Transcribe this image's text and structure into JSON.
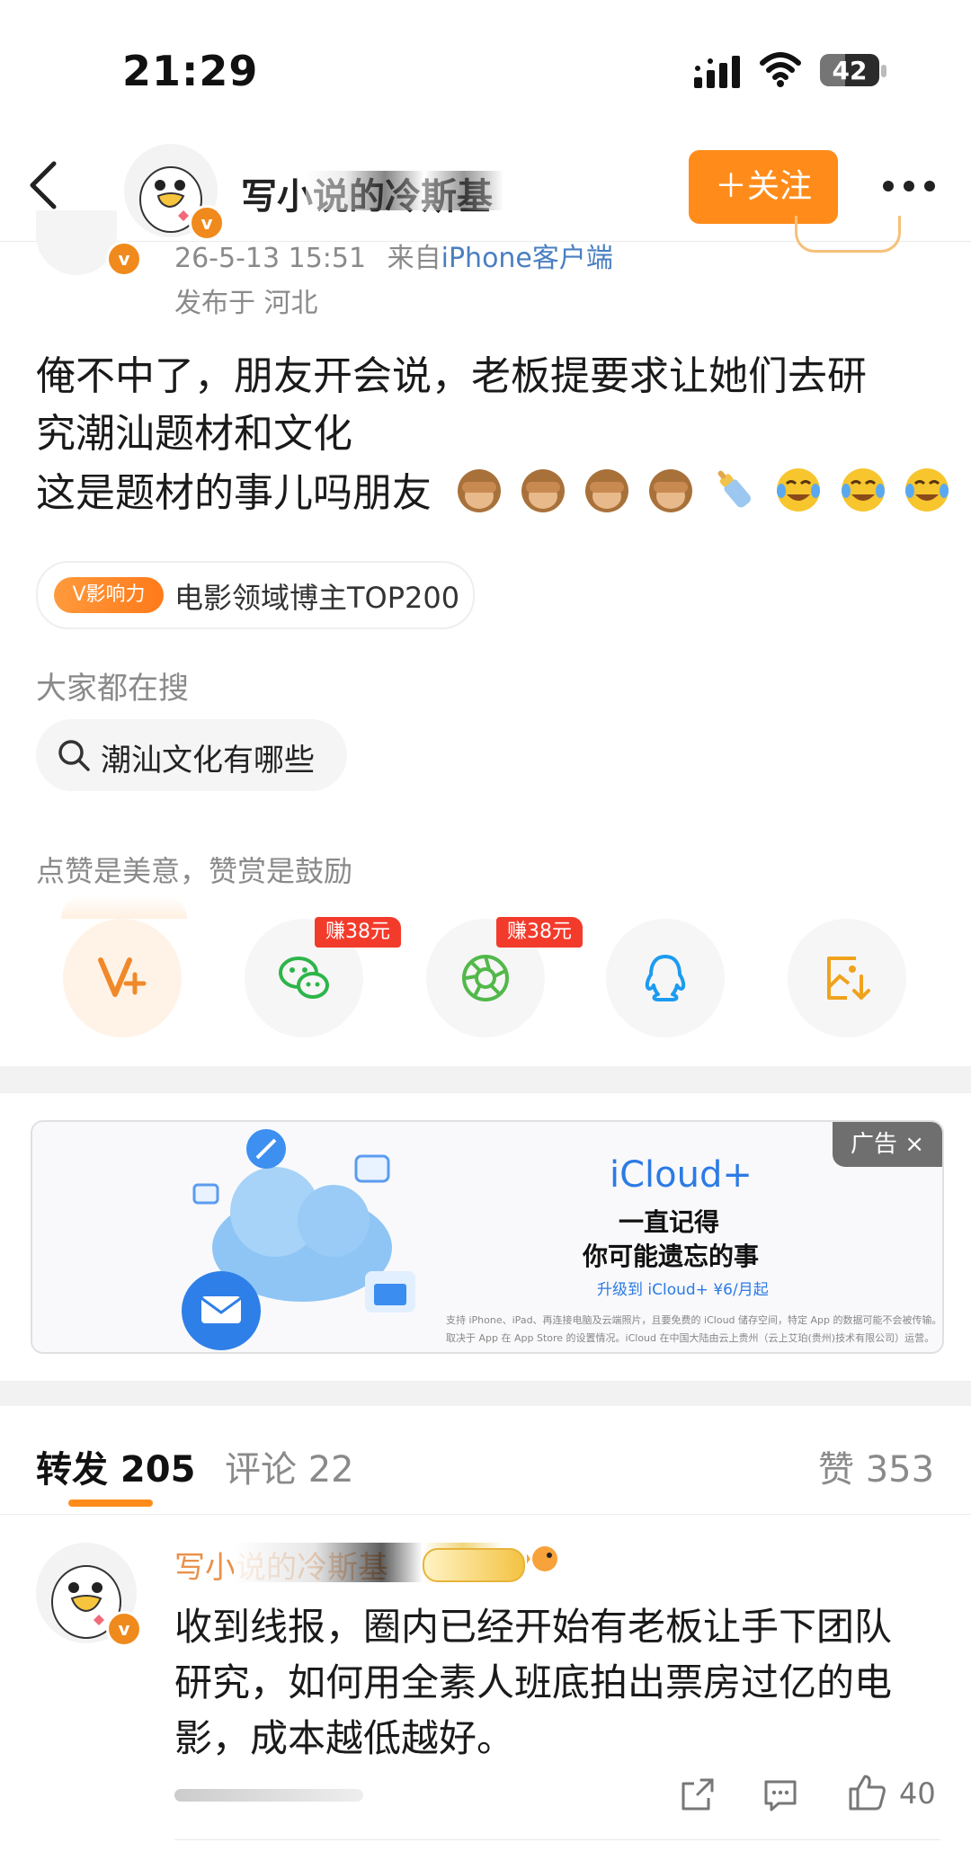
{
  "status_bar": {
    "time": "21:29",
    "battery": "42"
  },
  "header": {
    "username": "写小说的冷斯基",
    "follow_label": "＋关注"
  },
  "post": {
    "time": "26-5-13 15:51",
    "source_prefix": "来自",
    "source_app": "iPhone客户端",
    "location": "发布于 河北",
    "lines": [
      "俺不中了，朋友开会说，老板提要求让她们去研",
      "究潮汕题材和文化",
      "这是题材的事儿吗朋友"
    ],
    "emojis": [
      "see-no-evil-monkey",
      "see-no-evil-monkey",
      "see-no-evil-monkey",
      "see-no-evil-monkey",
      "baby-bottle",
      "tears-of-joy",
      "tears-of-joy",
      "tears-of-joy"
    ],
    "influence_badge": "V影响力",
    "influence_text": "电影领域博主TOP200"
  },
  "trending": {
    "label": "大家都在搜",
    "query": "潮汕文化有哪些"
  },
  "reward": {
    "label": "点赞是美意，赞赏是鼓励",
    "actions": [
      {
        "name": "reward",
        "icon": "v-plus-icon"
      },
      {
        "name": "wechat",
        "icon": "wechat-icon",
        "bonus": "赚38元"
      },
      {
        "name": "moments",
        "icon": "moments-icon",
        "bonus": "赚38元"
      },
      {
        "name": "qq",
        "icon": "qq-icon"
      },
      {
        "name": "save-image",
        "icon": "save-image-icon"
      }
    ]
  },
  "ad": {
    "tag": "广告 ×",
    "brand": "iCloud+",
    "line1": "一直记得",
    "line2": "你可能遗忘的事",
    "cta": "升级到 iCloud+ ¥6/月起",
    "fine1": "支持 iPhone、iPad、再连接电脑及云端照片，且要免费的 iCloud 储存空间，特定 App 的数据可能不会被传输。",
    "fine2": "取决于 App 在 App Store 的设置情况。iCloud 在中国大陆由云上贵州（云上艾珀(贵州)技术有限公司）运营。"
  },
  "tabs": {
    "repost": "转发 205",
    "comments": "评论 22",
    "likes": "赞 353"
  },
  "repost_item": {
    "username": "写小说的冷斯基",
    "lines": [
      "收到线报，圈内已经开始有老板让手下团队",
      "研究，如何用全素人班底拍出票房过亿的电",
      "影，成本越低越好。"
    ],
    "like_count": "40"
  },
  "colors": {
    "accent": "#ff8c1a",
    "link_blue": "#2c7be5",
    "bonus_red": "#f33b2c",
    "gray_text": "#8a8a8a"
  }
}
